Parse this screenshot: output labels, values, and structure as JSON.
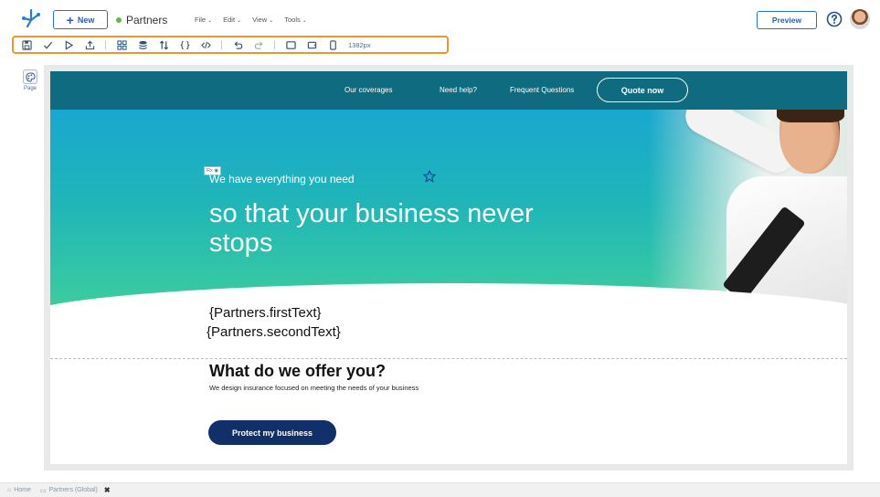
{
  "topbar": {
    "new_label": "New",
    "app_name": "Partners",
    "app_status_color": "#5fba46",
    "menus": [
      "File",
      "Edit",
      "View",
      "Tools"
    ],
    "preview_label": "Preview",
    "help_icon": "question-circle-icon"
  },
  "toolbar": {
    "icons": [
      "save-icon",
      "check-icon",
      "play-icon",
      "export-icon",
      "components-icon",
      "layers-icon",
      "sort-icon",
      "braces-icon",
      "code-icon",
      "undo-icon",
      "redo-icon",
      "desktop-view-icon",
      "tablet-view-icon",
      "mobile-view-icon"
    ],
    "width_value": "1382px",
    "highlight_color": "#e79a2a"
  },
  "sidebar": {
    "page_label": "Page"
  },
  "canvas": {
    "nav": {
      "links": [
        "Our coverages",
        "Need help?",
        "Frequent Questions"
      ],
      "cta": "Quote now"
    },
    "rx_tag": "Rx",
    "hero_subtitle": "We have everything you need",
    "hero_title": "so that your business never stops",
    "dynamic_1": "{Partners.firstText}",
    "dynamic_2": "{Partners.secondText}",
    "offer_title": "What do we offer you?",
    "offer_desc": "We design insurance focused on meeting the needs of your business",
    "protect_cta": "Protect my business",
    "colors": {
      "nav": "#0f6b7f",
      "gradient_top": "#1aa7cf",
      "gradient_bottom": "#3fcf9b",
      "cta": "#11306a"
    }
  },
  "bottom_tabs": {
    "home": "Home",
    "current": "Partners (Global)"
  }
}
